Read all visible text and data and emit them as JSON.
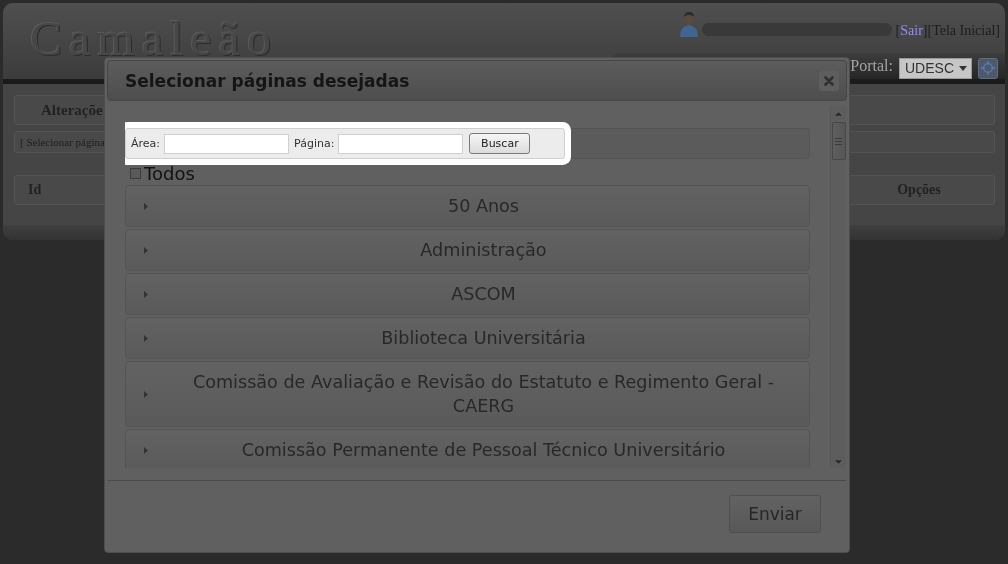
{
  "header": {
    "logo": "Camaleão",
    "links": [
      {
        "open": "[",
        "label": "Sair",
        "close": "]",
        "visited": false
      },
      {
        "open": "[",
        "label": "Tela Inicial",
        "close": "]",
        "visited": true
      }
    ],
    "portal": {
      "label": "Portal:",
      "value": "UDESC"
    }
  },
  "page": {
    "section_title": "Alteraçõe",
    "breadcrumb": "[ Selecionar página",
    "table": {
      "columns": [
        "Id",
        "Opções"
      ]
    }
  },
  "dialog": {
    "title": "Selecionar páginas desejadas",
    "search": {
      "highlighted": true,
      "fields": [
        {
          "label": "Área:"
        },
        {
          "label": "Página:"
        }
      ],
      "button": "Buscar"
    },
    "select_all": {
      "label": "Todos",
      "checked": false
    },
    "sections": [
      {
        "label": "50 Anos",
        "expanded": false
      },
      {
        "label": "Administração",
        "expanded": false
      },
      {
        "label": "ASCOM",
        "expanded": false
      },
      {
        "label": "Biblioteca Universitária",
        "expanded": false
      },
      {
        "label": "Comissão de Avaliação e Revisão do Estatuto e Regimento Geral - CAERG",
        "expanded": false
      },
      {
        "label": "Comissão Permanente de Pessoal Técnico Universitário",
        "expanded": false
      }
    ],
    "submit": "Enviar"
  }
}
